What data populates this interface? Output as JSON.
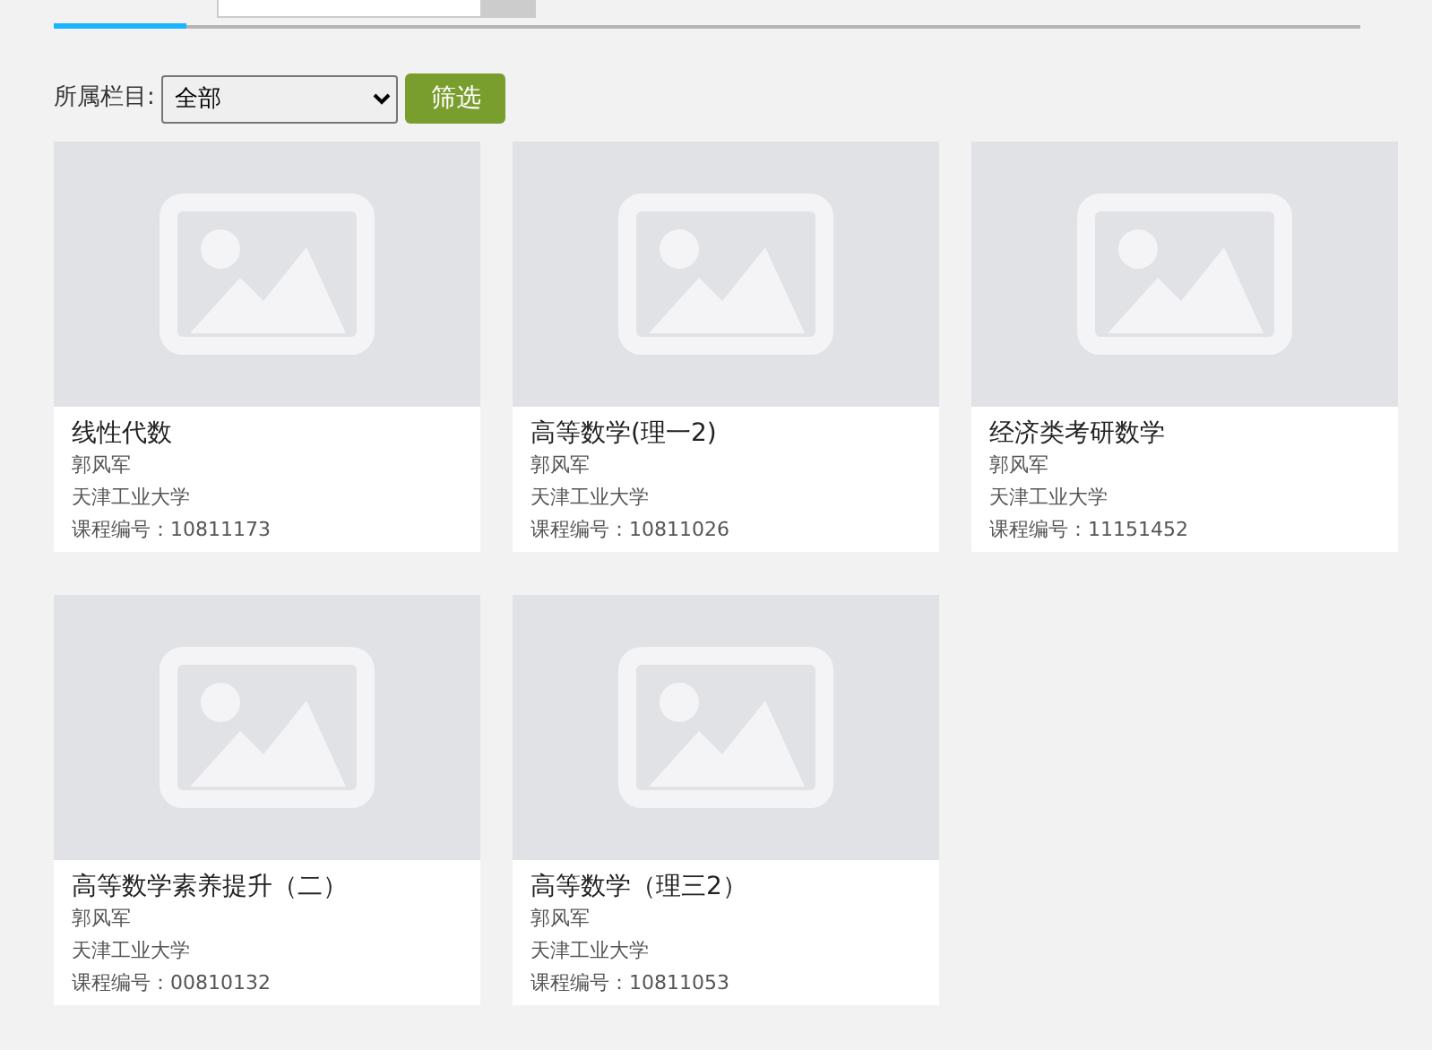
{
  "tabs": [
    {
      "selected": true
    }
  ],
  "filter": {
    "label": "所属栏目:",
    "value": "全部",
    "button": "筛选"
  },
  "courses": [
    {
      "title": "线性代数",
      "teacher": "郭风军",
      "school": "天津工业大学",
      "code": "课程编号：10811173"
    },
    {
      "title": "高等数学(理一2)",
      "teacher": "郭风军",
      "school": "天津工业大学",
      "code": "课程编号：10811026"
    },
    {
      "title": "经济类考研数学",
      "teacher": "郭风军",
      "school": "天津工业大学",
      "code": "课程编号：11151452"
    },
    {
      "title": "高等数学素养提升（二）",
      "teacher": "郭风军",
      "school": "天津工业大学",
      "code": "课程编号：00810132"
    },
    {
      "title": "高等数学（理三2）",
      "teacher": "郭风军",
      "school": "天津工业大学",
      "code": "课程编号：10811053"
    }
  ]
}
